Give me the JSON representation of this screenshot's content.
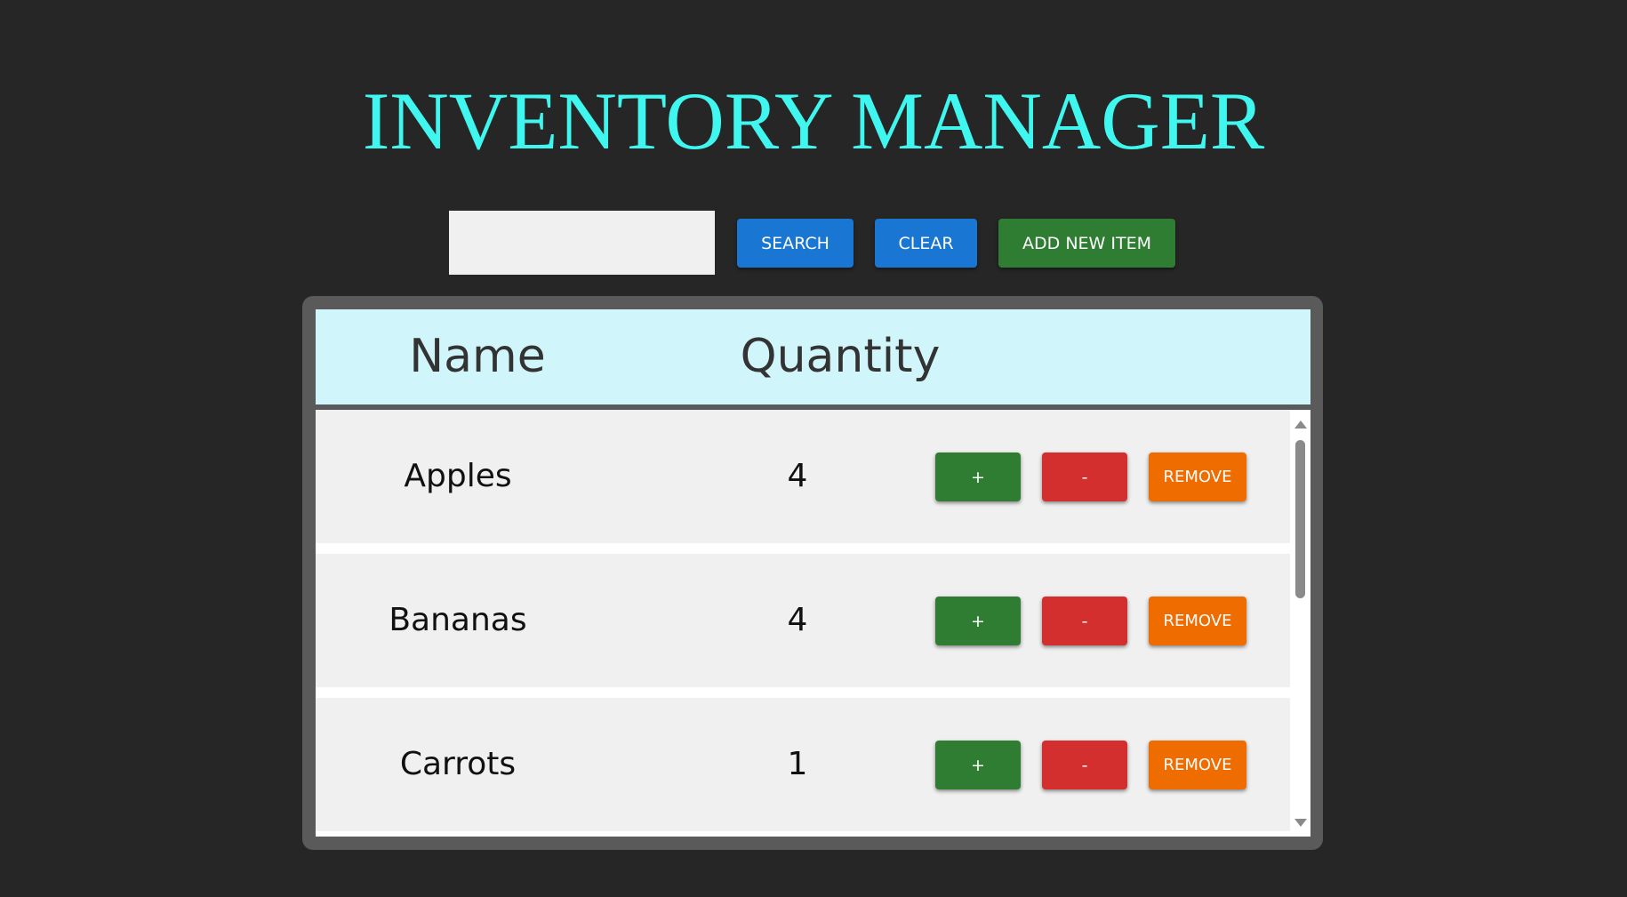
{
  "app": {
    "title": "INVENTORY MANAGER"
  },
  "toolbar": {
    "search_value": "",
    "search_placeholder": "",
    "search_label": "SEARCH",
    "clear_label": "CLEAR",
    "add_label": "ADD NEW ITEM"
  },
  "table": {
    "headers": {
      "name": "Name",
      "quantity": "Quantity"
    },
    "rows": [
      {
        "name": "Apples",
        "quantity": "4",
        "plus_label": "+",
        "minus_label": "-",
        "remove_label": "REMOVE"
      },
      {
        "name": "Bananas",
        "quantity": "4",
        "plus_label": "+",
        "minus_label": "-",
        "remove_label": "REMOVE"
      },
      {
        "name": "Carrots",
        "quantity": "1",
        "plus_label": "+",
        "minus_label": "-",
        "remove_label": "REMOVE"
      }
    ]
  },
  "icons": {
    "scroll_up": "triangle-up-icon",
    "scroll_down": "triangle-down-icon"
  },
  "colors": {
    "background": "#262626",
    "title": "#3ff7ee",
    "primary_button": "#1976d2",
    "success_button": "#2e7d32",
    "danger_button": "#d32f2f",
    "warning_button": "#ef6c00",
    "header_background": "#d0f6fb",
    "row_background": "#f0f0f0"
  }
}
